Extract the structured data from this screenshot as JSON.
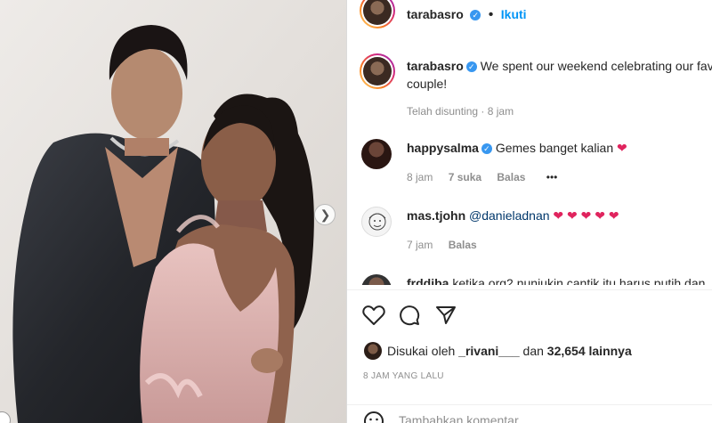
{
  "header": {
    "username": "tarabasro",
    "separator": "•",
    "follow_label": "Ikuti"
  },
  "caption": {
    "username": "tarabasro",
    "text_line1": "We spent our weekend celebrating our fav",
    "text_line2": "couple!",
    "edited": "Telah disunting · 8 jam"
  },
  "comments": [
    {
      "username": "happysalma",
      "text": "Gemes banget kalian",
      "hearts": "❤",
      "time": "8 jam",
      "likes": "7 suka",
      "reply": "Balas",
      "more": "•••"
    },
    {
      "username": "mas.tjohn",
      "mention": "@danieladnan",
      "hearts": "❤ ❤ ❤ ❤ ❤",
      "time": "7 jam",
      "reply": "Balas"
    },
    {
      "username": "frddiba",
      "text": "ketika org2 nunjukin cantik itu harus putih dan"
    }
  ],
  "likes": {
    "prefix": "Disukai oleh",
    "user": "_rivani___",
    "middle": "dan",
    "count": "32,654 lainnya"
  },
  "timestamp": "8 JAM YANG LALU",
  "add_comment": {
    "placeholder": "Tambahkan komentar..."
  },
  "icons": {
    "next": "chevron-right-icon",
    "like": "heart-icon",
    "comment": "comment-bubble-icon",
    "share": "paper-plane-icon",
    "emoji": "emoji-icon"
  },
  "colors": {
    "accent": "#0095f6",
    "verified": "#3897f0",
    "heart": "#e0245e",
    "muted": "#8e8e8e"
  }
}
